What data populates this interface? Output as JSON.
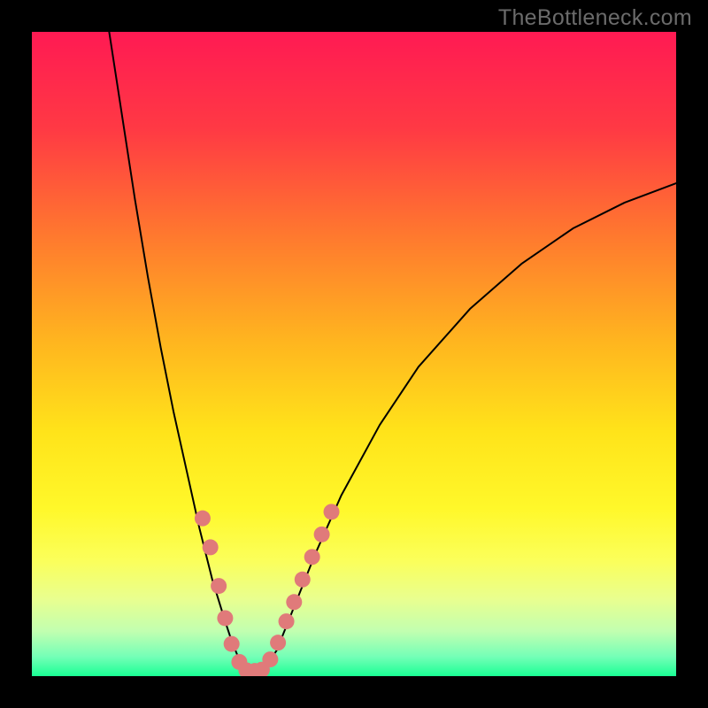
{
  "watermark": "TheBottleneck.com",
  "chart_data": {
    "type": "line",
    "title": "",
    "xlabel": "",
    "ylabel": "",
    "xlim": [
      0,
      100
    ],
    "ylim": [
      0,
      100
    ],
    "grid": false,
    "legend": false,
    "annotations": [],
    "background_gradient": {
      "stops": [
        {
          "pos": 0.0,
          "color": "#ff1a53"
        },
        {
          "pos": 0.15,
          "color": "#ff3944"
        },
        {
          "pos": 0.32,
          "color": "#ff7a2e"
        },
        {
          "pos": 0.48,
          "color": "#ffb51f"
        },
        {
          "pos": 0.62,
          "color": "#ffe31a"
        },
        {
          "pos": 0.74,
          "color": "#fff82a"
        },
        {
          "pos": 0.82,
          "color": "#fbff5a"
        },
        {
          "pos": 0.88,
          "color": "#e9ff8f"
        },
        {
          "pos": 0.93,
          "color": "#c2ffb0"
        },
        {
          "pos": 0.97,
          "color": "#74ffb7"
        },
        {
          "pos": 1.0,
          "color": "#1aff94"
        }
      ]
    },
    "series": [
      {
        "name": "left-branch",
        "type": "line",
        "color": "#000000",
        "width": 2,
        "x": [
          12,
          14,
          16,
          18,
          20,
          22,
          24,
          26,
          28,
          30,
          31,
          32,
          33
        ],
        "y": [
          100,
          87,
          74,
          62,
          51,
          41,
          32,
          23,
          15,
          8.5,
          5.5,
          3,
          1
        ]
      },
      {
        "name": "right-branch",
        "type": "line",
        "color": "#000000",
        "width": 2,
        "x": [
          36,
          38,
          40,
          44,
          48,
          54,
          60,
          68,
          76,
          84,
          92,
          100
        ],
        "y": [
          1,
          4,
          9,
          19,
          28,
          39,
          48,
          57,
          64,
          69.5,
          73.5,
          76.5
        ]
      },
      {
        "name": "bottom-flat",
        "type": "line",
        "color": "#000000",
        "width": 2,
        "x": [
          33,
          34,
          35,
          36
        ],
        "y": [
          1,
          0.7,
          0.7,
          1
        ]
      },
      {
        "name": "dots-left",
        "type": "scatter",
        "color": "#e07a7a",
        "radius": 9,
        "x": [
          26.5,
          27.7,
          29.0,
          30.0,
          31.0,
          32.2
        ],
        "y": [
          24.5,
          20.0,
          14.0,
          9.0,
          5.0,
          2.2
        ]
      },
      {
        "name": "dots-bottom",
        "type": "scatter",
        "color": "#e07a7a",
        "radius": 9,
        "x": [
          33.3,
          34.6,
          35.7
        ],
        "y": [
          0.9,
          0.8,
          1.0
        ]
      },
      {
        "name": "dots-right",
        "type": "scatter",
        "color": "#e07a7a",
        "radius": 9,
        "x": [
          37.0,
          38.2,
          39.5,
          40.7,
          42.0,
          43.5,
          45.0,
          46.5
        ],
        "y": [
          2.6,
          5.2,
          8.5,
          11.5,
          15.0,
          18.5,
          22.0,
          25.5
        ]
      }
    ]
  }
}
